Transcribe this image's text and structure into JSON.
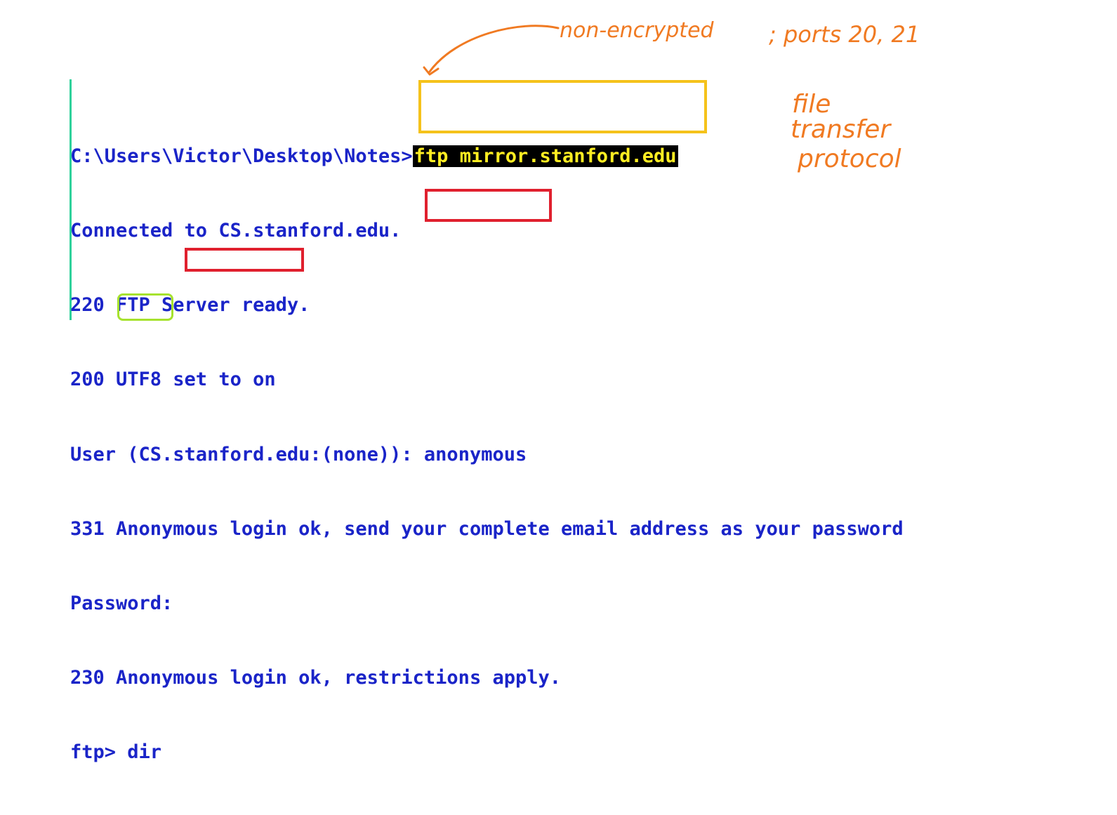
{
  "terminal": {
    "prompt_path": "C:\\Users\\Victor\\Desktop\\Notes>",
    "command": "ftp mirror.stanford.edu",
    "lines": [
      "Connected to CS.stanford.edu.",
      "220 FTP Server ready.",
      "200 UTF8 set to on"
    ],
    "user_prompt": "User (CS.stanford.edu:(none)): ",
    "user_value": "anonymous",
    "response_331": "331 Anonymous login ok, send your complete email address as your password",
    "password_prompt": "Password: ",
    "password_value": "",
    "response_230": "230 Anonymous login ok, restrictions apply.",
    "ftp_prompt": "ftp> ",
    "ftp_command": "dir"
  },
  "annotations": {
    "arrow_note": "non-encrypted",
    "ports_note": "; ports 20, 21",
    "acronym": [
      "file",
      "transfer",
      "protocol"
    ]
  },
  "colors": {
    "terminal_text": "#1a24c8",
    "command_highlight_bg": "#000000",
    "command_highlight_text": "#ffee22",
    "box_yellow": "#f5c21b",
    "box_red": "#e0202e",
    "box_green": "#a6e22e",
    "handwriting": "#f07a22",
    "margin_bar": "#2fd19a"
  }
}
